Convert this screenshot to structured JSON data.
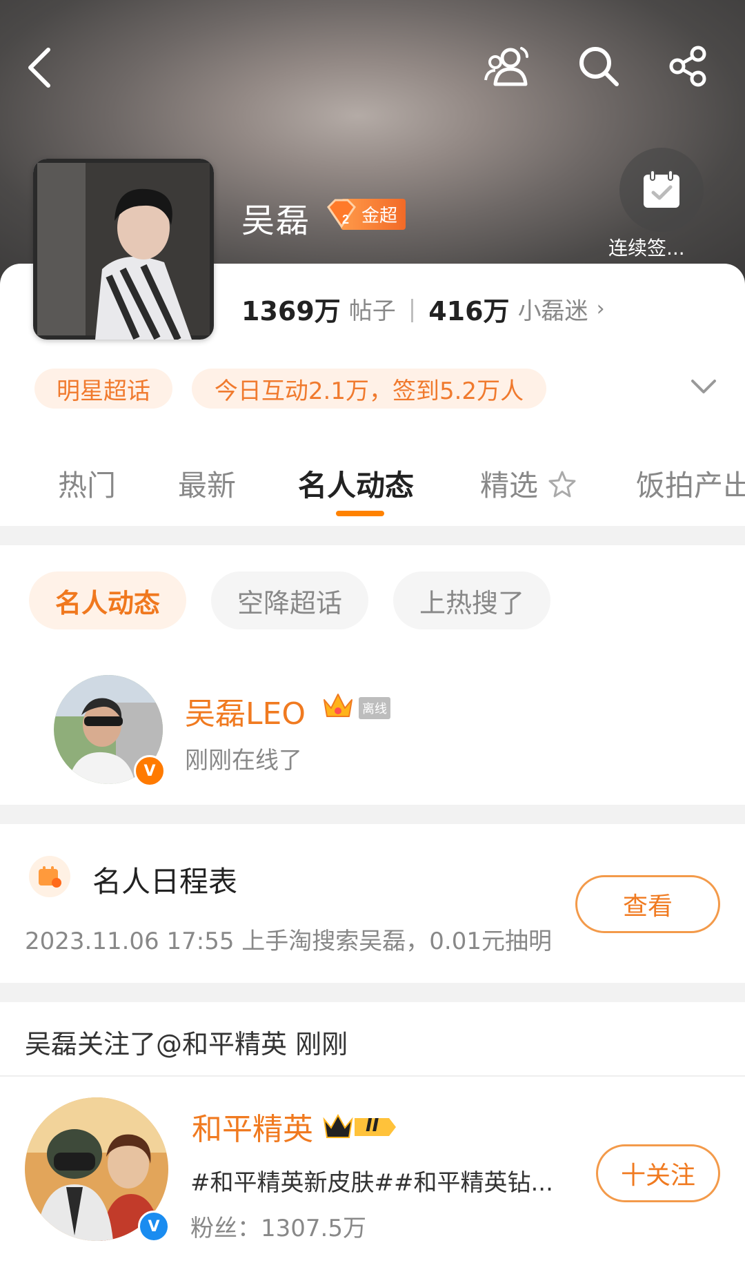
{
  "header": {
    "back_icon": "back-arrow-icon",
    "icons": [
      "community-icon",
      "search-icon",
      "share-icon"
    ]
  },
  "profile": {
    "name": "吴磊",
    "level_badge": "金超",
    "checkin_label": "连续签...",
    "posts_count": "1369万",
    "posts_label": "帖子",
    "fans_count": "416万",
    "fans_label": "小磊迷"
  },
  "info_pills": {
    "type": "明星超话",
    "stats": "今日互动2.1万，签到5.2万人"
  },
  "tabs": [
    "热门",
    "最新",
    "名人动态",
    "精选",
    "饭拍产出"
  ],
  "active_tab": "名人动态",
  "filter_chips": [
    "名人动态",
    "空降超话",
    "上热搜了"
  ],
  "celebrity": {
    "name": "吴磊LEO",
    "status_tag": "离线",
    "status_text": "刚刚在线了"
  },
  "schedule": {
    "title": "名人日程表",
    "detail": "2023.11.06 17:55 上手淘搜索吴磊，0.01元抽明",
    "button": "查看"
  },
  "follow_event": {
    "headline": "吴磊关注了@和平精英 刚刚",
    "account_name": "和平精英",
    "level": "II",
    "description": "#和平精英新皮肤##和平精英钻...",
    "fans": "粉丝：1307.5万",
    "button": "十关注"
  },
  "colors": {
    "accent": "#ff8200",
    "accent_text": "#f07a20",
    "pill_bg": "#fff1e7"
  }
}
